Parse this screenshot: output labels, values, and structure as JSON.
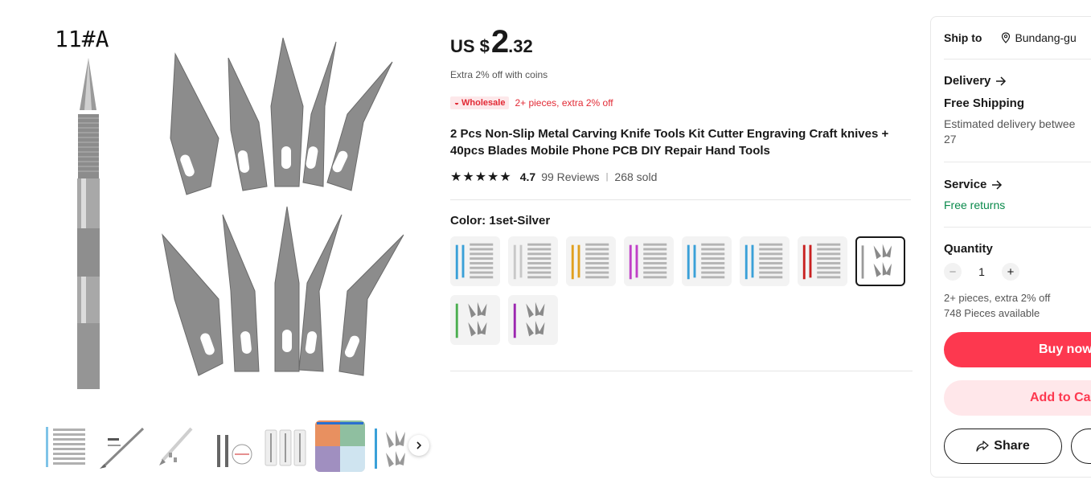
{
  "gallery": {
    "main_image_label": "11#A",
    "thumbnails": [
      "thumb-1",
      "thumb-2",
      "thumb-3",
      "thumb-4",
      "thumb-5",
      "thumb-6",
      "thumb-7"
    ],
    "next_icon": "chevron-right-icon"
  },
  "product": {
    "price_currency": "US $",
    "price_integer": "2",
    "price_decimal": ".32",
    "coins_text": "Extra 2% off with coins",
    "wholesale_badge": "Wholesale",
    "wholesale_offer": "2+ pieces, extra 2% off",
    "title": "2 Pcs Non-Slip Metal Carving Knife Tools Kit Cutter Engraving Craft knives + 40pcs Blades Mobile Phone PCB DIY Repair Hand Tools",
    "rating_score": "4.7",
    "reviews": "99 Reviews",
    "sold": "268 sold",
    "stars": 4.7,
    "color_label": "Color: 1set-Silver",
    "swatches": [
      {
        "handle": "#3aa0d8"
      },
      {
        "handle": "#c8c8c8"
      },
      {
        "handle": "#e0a020"
      },
      {
        "handle": "#c040c8"
      },
      {
        "handle": "#3aa0d8"
      },
      {
        "handle": "#3aa0d8"
      },
      {
        "handle": "#c82020"
      },
      {
        "handle": "#9a9a9a",
        "selected": true
      },
      {
        "handle": "#4caf50"
      },
      {
        "handle": "#9c27b0"
      }
    ]
  },
  "panel": {
    "ship_to_label": "Ship to",
    "ship_to_location": "Bundang-gu",
    "delivery_label": "Delivery",
    "free_shipping": "Free Shipping",
    "estimated_line1": "Estimated delivery betwee",
    "estimated_line2": "27",
    "service_label": "Service",
    "free_returns": "Free returns",
    "quantity_label": "Quantity",
    "quantity_value": "1",
    "qty_offer": "2+ pieces, extra 2% off",
    "pieces_available": "748 Pieces available",
    "buy_now": "Buy now",
    "add_to_cart": "Add to Ca",
    "share": "Share"
  },
  "colors": {
    "accent_red": "#fd384f",
    "green": "#0a8a4b"
  }
}
